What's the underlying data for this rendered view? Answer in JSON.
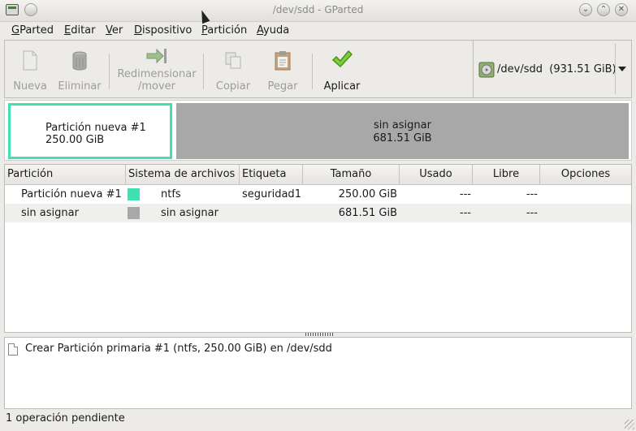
{
  "window": {
    "title": "/dev/sdd - GParted"
  },
  "menu": [
    {
      "first": "G",
      "rest": "Parted"
    },
    {
      "first": "E",
      "rest": "ditar"
    },
    {
      "first": "V",
      "rest": "er"
    },
    {
      "first": "D",
      "rest": "ispositivo"
    },
    {
      "first": "P",
      "rest": "artición"
    },
    {
      "first": "A",
      "rest": "yuda"
    }
  ],
  "toolbar": {
    "new": "Nueva",
    "delete": "Eliminar",
    "resize_1": "Redimensionar",
    "resize_2": "/mover",
    "copy": "Copiar",
    "paste": "Pegar",
    "apply": "Aplicar"
  },
  "device": {
    "label": "/dev/sdd  (931.51 GiB)"
  },
  "diskmap": {
    "new_partition": {
      "name": "Partición nueva #1",
      "size": "250.00 GiB",
      "color": "#3fe0b4"
    },
    "unallocated": {
      "name": "sin asignar",
      "size": "681.51 GiB",
      "color": "#a8a8a8"
    }
  },
  "table": {
    "headers": [
      "Partición",
      "Sistema de archivos",
      "Etiqueta",
      "Tamaño",
      "Usado",
      "Libre",
      "Opciones"
    ],
    "rows": [
      {
        "partition": "Partición nueva #1",
        "fs": "ntfs",
        "fs_color": "#3fe0b4",
        "label": "seguridad1",
        "size": "250.00 GiB",
        "used": "---",
        "free": "---",
        "flags": ""
      },
      {
        "partition": "sin asignar",
        "fs": "sin asignar",
        "fs_color": "#a8a8a8",
        "label": "",
        "size": "681.51 GiB",
        "used": "---",
        "free": "---",
        "flags": ""
      }
    ]
  },
  "operations": [
    "Crear Partición primaria #1 (ntfs, 250.00 GiB) en /dev/sdd"
  ],
  "status": "1 operación pendiente"
}
